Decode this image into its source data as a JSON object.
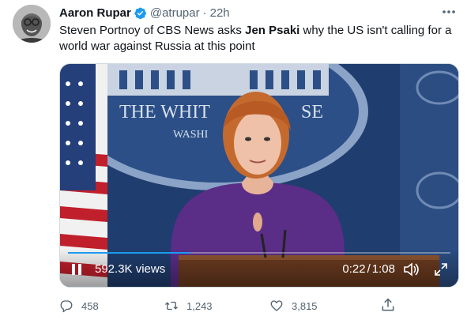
{
  "tweet": {
    "author_name": "Aaron Rupar",
    "handle": "@atrupar",
    "separator": "·",
    "time": "22h",
    "text_before": "Steven Portnoy of CBS News asks ",
    "text_bold": "Jen Psaki",
    "text_after": " why the US isn't calling for a world war against Russia at this point"
  },
  "video": {
    "podium_sign_line1": "THE WHIT",
    "podium_sign_line1b": "SE",
    "podium_sign_line2": "WASHI",
    "views": "592.3K views",
    "time_current": "0:22",
    "time_separator": "/",
    "time_total": "1:08",
    "progress": 0.32
  },
  "actions": {
    "replies": "458",
    "retweets": "1,243",
    "likes": "3,815"
  },
  "icons": {
    "verified": "verified-badge-icon",
    "more": "more-icon",
    "reply": "reply-icon",
    "retweet": "retweet-icon",
    "like": "heart-icon",
    "share": "share-icon"
  },
  "colors": {
    "accent": "#1d9bf0",
    "muted": "#536471",
    "text": "#0f1419"
  }
}
